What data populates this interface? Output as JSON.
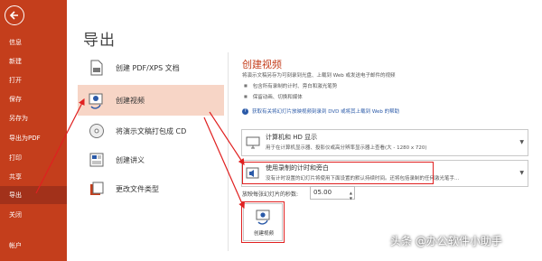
{
  "sidebar": {
    "items": [
      {
        "label": "信息"
      },
      {
        "label": "新建"
      },
      {
        "label": "打开"
      },
      {
        "label": "保存"
      },
      {
        "label": "另存为"
      },
      {
        "label": "导出为PDF"
      },
      {
        "label": "打印"
      },
      {
        "label": "共享"
      },
      {
        "label": "导出"
      },
      {
        "label": "关闭"
      },
      {
        "label": "帐户"
      }
    ]
  },
  "page": {
    "title": "导出"
  },
  "options": [
    {
      "label": "创建 PDF/XPS 文档",
      "icon": "pdf-icon"
    },
    {
      "label": "创建视频",
      "icon": "video-icon"
    },
    {
      "label": "将演示文稿打包成 CD",
      "icon": "cd-icon"
    },
    {
      "label": "创建讲义",
      "icon": "handout-icon"
    },
    {
      "label": "更改文件类型",
      "icon": "filetype-icon"
    }
  ],
  "detail": {
    "title": "创建视频",
    "desc": "将演示文稿另存为可刻录到光盘、上载到 Web 或发送电子邮件的视频",
    "bullets": [
      "包含所有录制的计时、旁白和激光笔势",
      "保留动画、切换和媒体"
    ],
    "help": "获取有关将幻灯片放映视频刻录到 DVD 或将其上载到 Web 的帮助",
    "quality": {
      "title": "计算机和 HD 显示",
      "sub": "用于在计算机显示器、投影仪或高分辨率显示器上查看(大 - 1280 x 720)"
    },
    "timing": {
      "title": "使用录制的计时和旁白",
      "sub": "没有计时设置的幻灯片将使用下面设置的默认持续时间。还将包括录制的任何激光笔手..."
    },
    "seconds_label": "放映每张幻灯片的秒数:",
    "seconds_value": "05.00",
    "create_button": "创建视频"
  },
  "watermark": "头条 @办公软件小助手",
  "colors": {
    "accent": "#c43e1c",
    "highlight": "#e02020",
    "selected_bg": "#f7d5c6"
  }
}
